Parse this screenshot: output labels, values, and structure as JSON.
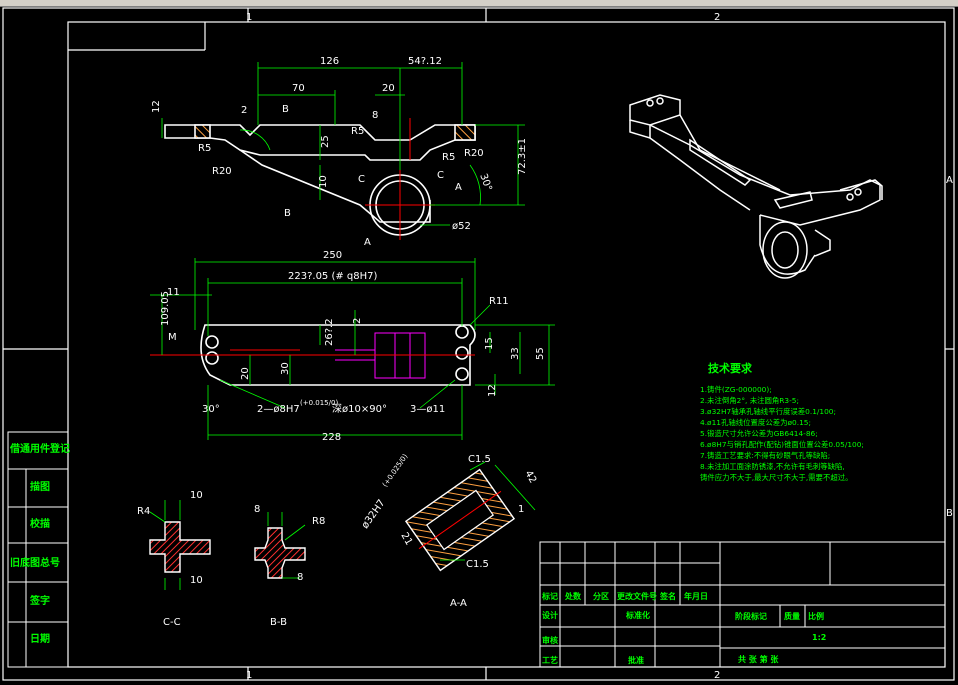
{
  "colors": {
    "background": "#000000",
    "frame": "#ffffff",
    "dimension": "#00ff00",
    "text": "#ffffff",
    "dimension_text": "#ffffff",
    "tech_text": "#00ff00",
    "center_line": "#ff0000",
    "hidden": "#ff00ff",
    "hatch": "#ff3030",
    "table_text": "#00ff00"
  },
  "border": {
    "zone_top_1": "1",
    "zone_top_2": "2",
    "zone_bottom_1": "1",
    "zone_bottom_2": "2",
    "zone_right_a": "A",
    "zone_right_b": "B"
  },
  "side_table": {
    "rows": [
      "借通用件登记",
      "描图",
      "校描",
      "旧底图总号",
      "签字",
      "日期"
    ]
  },
  "dims": {
    "top_126": "126",
    "top_54212": "54?.12",
    "top_70": "70",
    "top_20": "20",
    "top_12": "12",
    "top_2": "2",
    "sec_b": "B",
    "r5_left": "R5",
    "r5_mid": "R5",
    "r5_right": "R5",
    "r20_left": "R20",
    "r20_right": "R20",
    "d25": "25",
    "d10": "10",
    "d8": "8",
    "d72": "72.3±1",
    "d30deg": "30°",
    "sec_a": "A",
    "sec_c": "C",
    "dia52": "ø52",
    "plan_250": "250",
    "plan_223": "223?.05 (# q8H7)",
    "plan_11": "11",
    "plan_109": "109.05",
    "plan_m": "M",
    "plan_r11": "R11",
    "plan_2": "2",
    "plan_262": "26?.2",
    "plan_15": "15",
    "plan_33": "33",
    "plan_55": "55",
    "plan_20": "20",
    "plan_30": "30",
    "plan_12": "12",
    "plan_30deg": "30°",
    "plan_hole": "2—ø8H7",
    "plan_hole_tol": "(+0.015/0)",
    "plan_hole_rest": "深ø10×90°",
    "plan_3holes": "3—ø11",
    "plan_228": "228",
    "cc_r4": "R4",
    "cc_10top": "10",
    "cc_10bot": "10",
    "cc_label": "C-C",
    "bb_8": "8",
    "bb_r8": "R8",
    "bb_8b": "8",
    "bb_label": "B-B",
    "aa_c15_top": "C1.5",
    "aa_c15_bot": "C1.5",
    "aa_dia32": "ø32H7",
    "aa_tol": "(+0.025/0)",
    "aa_42": "42",
    "aa_1": "1",
    "aa_21": "21",
    "aa_label": "A-A"
  },
  "tech": {
    "title": "技术要求",
    "lines": [
      "1.铸件(ZG-000000);",
      "2.未注倒角2°, 未注圆角R3-5;",
      "3.ø32H7轴承孔轴线平行度误差0.1/100;",
      "4.ø11孔轴线位置度公差为ø0.15;",
      "5.锻造尺寸允许公差为GB6414-86;",
      "6.ø8H7与销孔配作(配钻)锥面位置公差0.05/100;",
      "7.铸造工艺要求:不得有砂眼气孔等缺陷;",
      "8.未注加工面涂防锈漆,不允许有毛刺等缺陷,",
      "  铸件应力不大于,最大尺寸不大于,需要不超过。"
    ]
  },
  "title_block": {
    "row_labels": [
      "标记",
      "处数",
      "分区",
      "更改文件号",
      "签名",
      "年月日"
    ],
    "design": "设计",
    "standard": "标准化",
    "review": "审核",
    "process": "工艺",
    "approve": "批准",
    "stage": "阶段标记",
    "weight": "质量",
    "scale": "比例",
    "scale_val": "1:2",
    "sheets": "共   张   第   张"
  }
}
